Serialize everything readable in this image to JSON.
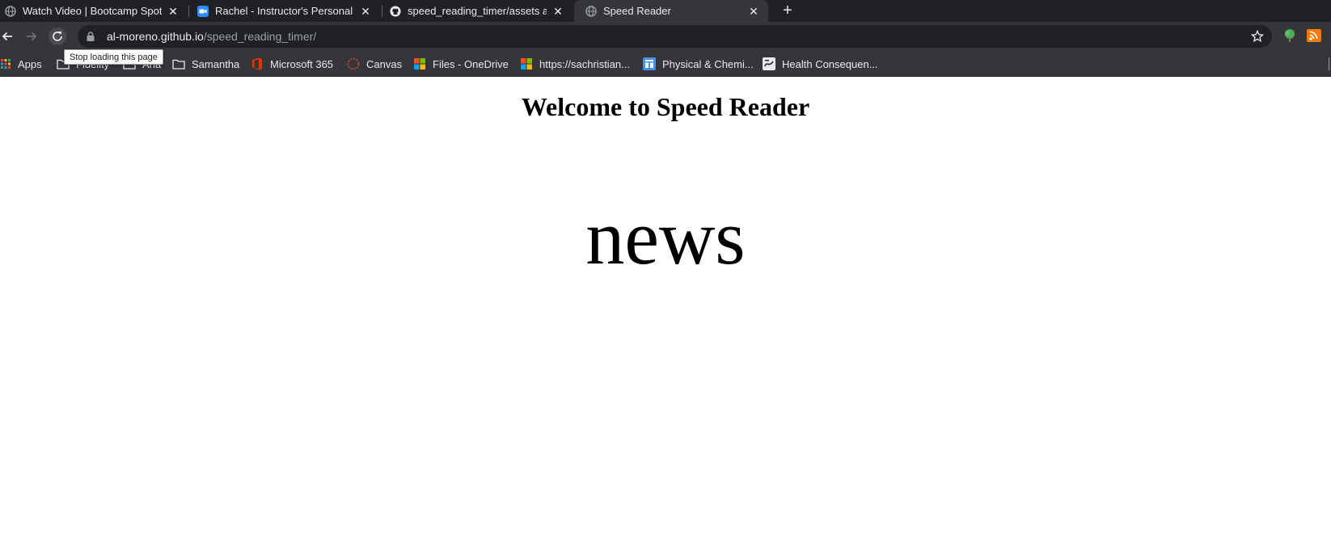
{
  "browser": {
    "tabs": [
      {
        "title": "Watch Video | Bootcamp Spot",
        "icon": "globe-icon",
        "active": false
      },
      {
        "title": "Rachel - Instructor's Personal M",
        "icon": "zoom-video-icon",
        "active": false
      },
      {
        "title": "speed_reading_timer/assets at",
        "icon": "github-icon",
        "active": false
      },
      {
        "title": "Speed Reader",
        "icon": "globe-icon",
        "active": true
      }
    ],
    "address": {
      "domain": "al-moreno.github.io",
      "path": "/speed_reading_timer/"
    },
    "tooltip": "Stop loading this page",
    "bookmarks": [
      {
        "label": "Apps",
        "icon": "apps-grid-icon"
      },
      {
        "label": "Fidelity",
        "icon": "folder-icon"
      },
      {
        "label": "Ana",
        "icon": "folder-icon"
      },
      {
        "label": "Samantha",
        "icon": "folder-icon"
      },
      {
        "label": "Microsoft 365",
        "icon": "office-icon"
      },
      {
        "label": "Canvas",
        "icon": "canvas-icon"
      },
      {
        "label": "Files - OneDrive",
        "icon": "microsoft-icon"
      },
      {
        "label": "https://sachristian...",
        "icon": "microsoft-icon"
      },
      {
        "label": "Physical & Chemi...",
        "icon": "doc-icon"
      },
      {
        "label": "Health Consequen...",
        "icon": "page-icon"
      }
    ],
    "colors": {
      "tabstrip": "#202124",
      "toolbar": "#35363a",
      "text": "#e8eaed"
    }
  },
  "page": {
    "heading": "Welcome to Speed Reader",
    "current_word": "news"
  }
}
